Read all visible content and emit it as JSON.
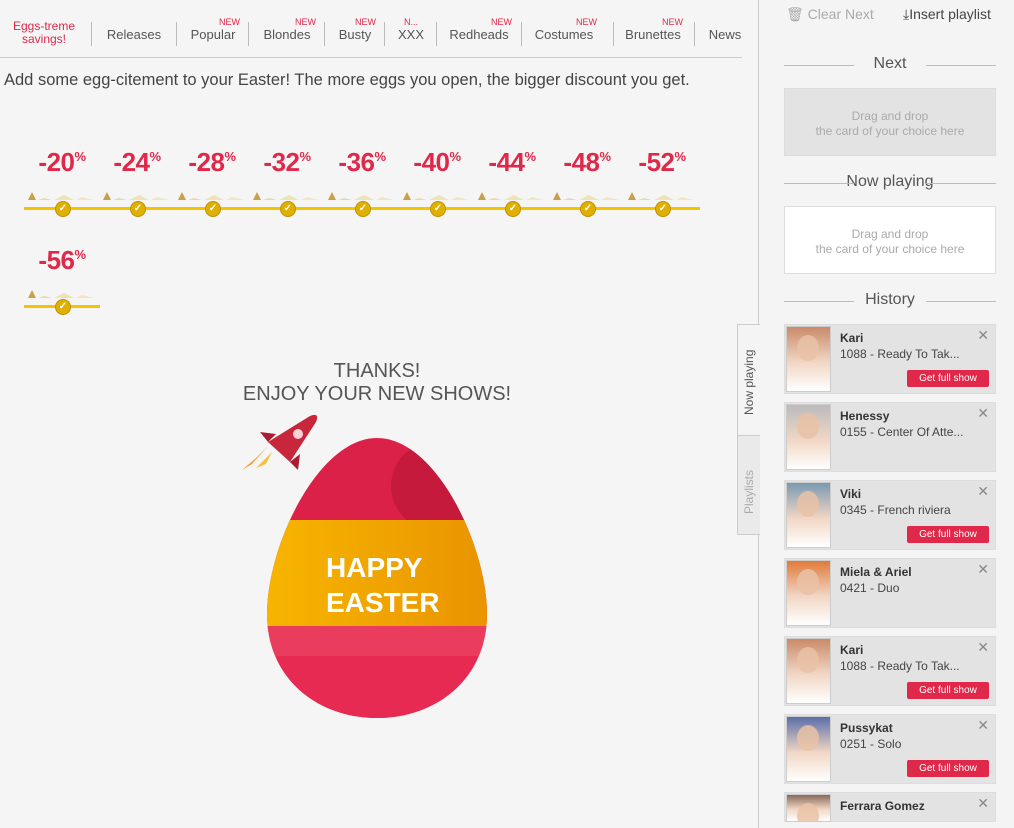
{
  "nav": {
    "promo": "Eggs-treme savings!",
    "tabs": [
      {
        "label": "Releases",
        "new": ""
      },
      {
        "label": "Popular",
        "new": "NEW"
      },
      {
        "label": "Blondes",
        "new": "NEW"
      },
      {
        "label": "Busty",
        "new": "NEW"
      },
      {
        "label": "XXX",
        "new": "N..."
      },
      {
        "label": "Redheads",
        "new": "NEW"
      },
      {
        "label": "Costumes",
        "new": "NEW"
      },
      {
        "label": "Brunettes",
        "new": "NEW"
      },
      {
        "label": "News",
        "new": ""
      }
    ]
  },
  "headline": "Add some egg-citement to your Easter! The more eggs you open, the bigger discount you get.",
  "discounts": [
    "-20",
    "-24",
    "-28",
    "-32",
    "-36",
    "-40",
    "-44",
    "-48",
    "-52",
    "-56"
  ],
  "discount_unit": "%",
  "thanks": {
    "line1": "THANKS!",
    "line2": "ENJOY YOUR NEW SHOWS!"
  },
  "egg": {
    "text1": "HAPPY",
    "text2": "EASTER"
  },
  "sidebar": {
    "clear_next": "Clear Next",
    "insert_playlist": "Insert playlist",
    "next_title": "Next",
    "now_playing_title": "Now playing",
    "history_title": "History",
    "dropzone_line1": "Drag and drop",
    "dropzone_line2": "the card of your choice here",
    "tab_now_playing": "Now playing",
    "tab_playlists": "Playlists",
    "history": [
      {
        "name": "Kari",
        "sub": "1088 - Ready To Tak...",
        "button": "Get full show"
      },
      {
        "name": "Henessy",
        "sub": "0155 - Center Of Atte...",
        "button": ""
      },
      {
        "name": "Viki",
        "sub": "0345 - French riviera",
        "button": "Get full show"
      },
      {
        "name": "Miela & Ariel",
        "sub": "0421 - Duo",
        "button": ""
      },
      {
        "name": "Kari",
        "sub": "1088 - Ready To Tak...",
        "button": "Get full show"
      },
      {
        "name": "Pussykat",
        "sub": "0251 - Solo",
        "button": "Get full show"
      },
      {
        "name": "Ferrara Gomez",
        "sub": "",
        "button": ""
      }
    ]
  },
  "colors": {
    "accent": "#e0284a",
    "gold": "#f2c500"
  }
}
